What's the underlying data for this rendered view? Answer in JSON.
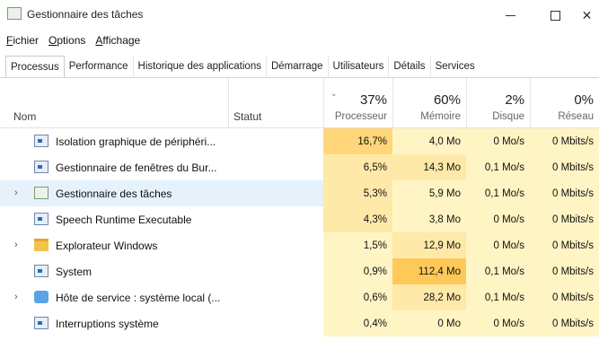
{
  "window": {
    "title": "Gestionnaire des tâches",
    "min_label": "–",
    "max_label": "□",
    "close_label": "✕"
  },
  "menu": {
    "items": [
      {
        "first": "F",
        "rest": "ichier"
      },
      {
        "first": "O",
        "rest": "ptions"
      },
      {
        "first": "A",
        "rest": "ffichage"
      }
    ]
  },
  "tabs": [
    "Processus",
    "Performance",
    "Historique des applications",
    "Démarrage",
    "Utilisateurs",
    "Détails",
    "Services"
  ],
  "active_tab": "Processus",
  "header": {
    "name": "Nom",
    "status": "Statut",
    "cpu": {
      "pct": "37%",
      "label": "Processeur"
    },
    "mem": {
      "pct": "60%",
      "label": "Mémoire"
    },
    "disk": {
      "pct": "2%",
      "label": "Disque"
    },
    "net": {
      "pct": "0%",
      "label": "Réseau"
    }
  },
  "colors": {
    "heat_low": "#fff4c4",
    "heat_mid": "#ffe9a8",
    "heat_high": "#ffd67a",
    "heat_max": "#ffc95a",
    "selected_row": "#e5f1fb"
  },
  "processes": [
    {
      "name": "Isolation graphique de périphéri...",
      "icon": "window-icon",
      "expandable": false,
      "cpu": "16,7%",
      "mem": "4,0 Mo",
      "disk": "0 Mo/s",
      "net": "0 Mbits/s"
    },
    {
      "name": "Gestionnaire de fenêtres du Bur...",
      "icon": "window-icon",
      "expandable": false,
      "cpu": "6,5%",
      "mem": "14,3 Mo",
      "disk": "0,1 Mo/s",
      "net": "0 Mbits/s"
    },
    {
      "name": "Gestionnaire des tâches",
      "icon": "task-manager-icon",
      "expandable": true,
      "selected": true,
      "cpu": "5,3%",
      "mem": "5,9 Mo",
      "disk": "0,1 Mo/s",
      "net": "0 Mbits/s"
    },
    {
      "name": "Speech Runtime Executable",
      "icon": "window-icon",
      "expandable": false,
      "cpu": "4,3%",
      "mem": "3,8 Mo",
      "disk": "0 Mo/s",
      "net": "0 Mbits/s"
    },
    {
      "name": "Explorateur Windows",
      "icon": "folder-icon",
      "expandable": true,
      "cpu": "1,5%",
      "mem": "12,9 Mo",
      "disk": "0 Mo/s",
      "net": "0 Mbits/s"
    },
    {
      "name": "System",
      "icon": "window-icon",
      "expandable": false,
      "cpu": "0,9%",
      "mem": "112,4 Mo",
      "disk": "0,1 Mo/s",
      "net": "0 Mbits/s"
    },
    {
      "name": "Hôte de service : système local (...",
      "icon": "gear-icon",
      "expandable": true,
      "cpu": "0,6%",
      "mem": "28,2 Mo",
      "disk": "0,1 Mo/s",
      "net": "0 Mbits/s"
    },
    {
      "name": "Interruptions système",
      "icon": "window-icon",
      "expandable": false,
      "cpu": "0,4%",
      "mem": "0 Mo",
      "disk": "0 Mo/s",
      "net": "0 Mbits/s"
    }
  ]
}
